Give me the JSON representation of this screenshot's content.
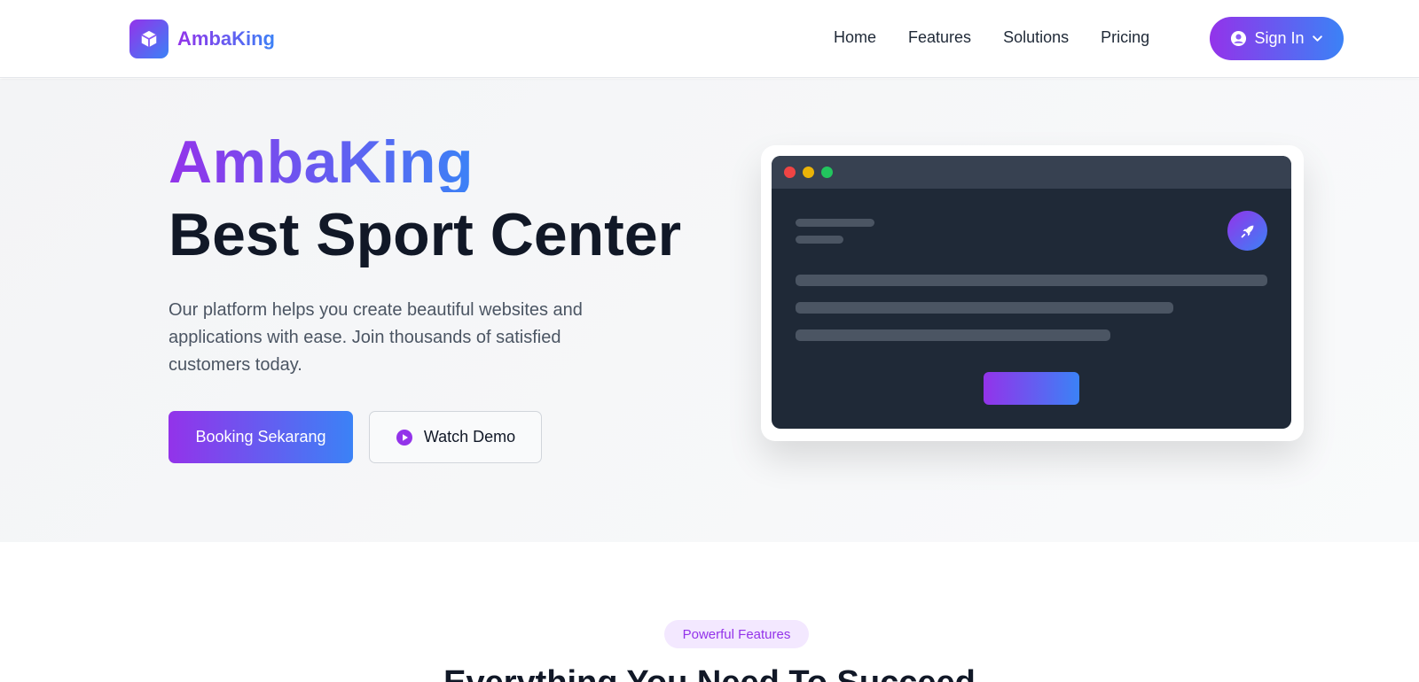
{
  "header": {
    "brand_name": "AmbaKing",
    "nav": [
      "Home",
      "Features",
      "Solutions",
      "Pricing"
    ],
    "signin_label": "Sign In"
  },
  "hero": {
    "brand": "AmbaKing",
    "title": "Best Sport Center",
    "description": "Our platform helps you create beautiful websites and applications with ease. Join thousands of satisfied customers today.",
    "primary_button": "Booking Sekarang",
    "secondary_button": "Watch Demo"
  },
  "features": {
    "badge": "Powerful Features",
    "title": "Everything You Need To Succeed"
  },
  "colors": {
    "brand_start": "#9333ea",
    "brand_end": "#3b82f6",
    "mock_dark": "#1f2937",
    "dot_red": "#ef4444",
    "dot_yellow": "#eab308",
    "dot_green": "#22c55e"
  },
  "icons": {
    "logo": "cube-icon",
    "signin": "user-circle-icon",
    "dropdown": "chevron-down-icon",
    "demo": "play-circle-icon",
    "mock": "rocket-icon"
  }
}
